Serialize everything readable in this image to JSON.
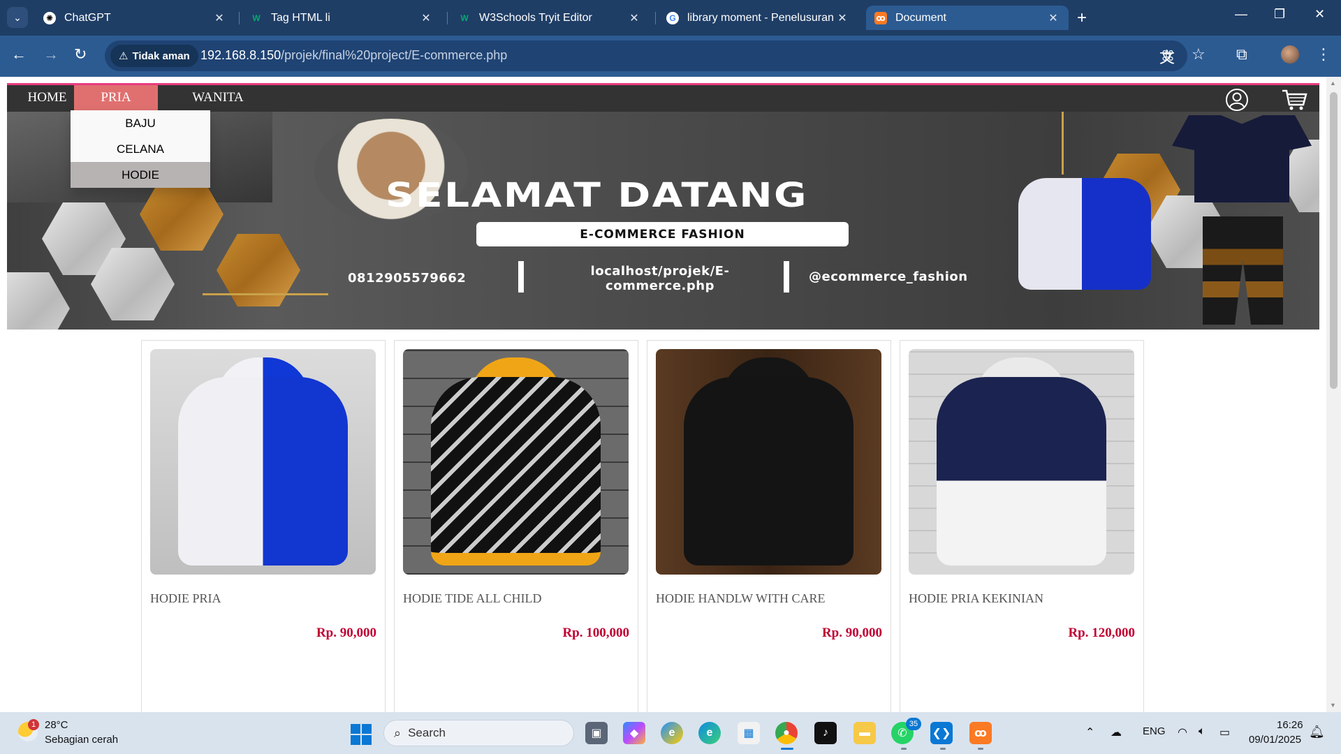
{
  "browser": {
    "tabs": [
      {
        "title": "ChatGPT",
        "icon": "chatgpt-icon"
      },
      {
        "title": "Tag HTML li",
        "icon": "w3-icon"
      },
      {
        "title": "W3Schools Tryit Editor",
        "icon": "w3-icon"
      },
      {
        "title": "library moment - Penelusuran G",
        "icon": "google-icon"
      },
      {
        "title": "Document",
        "icon": "xampp-icon",
        "active": true
      }
    ],
    "security_label": "Tidak aman",
    "url_host": "192.168.8.150",
    "url_path": "/projek/final%20project/E-commerce.php"
  },
  "site": {
    "nav": [
      "HOME",
      "PRIA",
      "WANITA"
    ],
    "active_nav": "PRIA",
    "dropdown": [
      "BAJU",
      "CELANA",
      "HODIE"
    ],
    "dropdown_hover": "HODIE",
    "banner": {
      "title": "SELAMAT DATANG",
      "subtitle": "E-COMMERCE FASHION",
      "phone": "0812905579662",
      "link_line1": "localhost/projek/E-",
      "link_line2": "commerce.php",
      "instagram": "@ecommerce_fashion"
    },
    "products": [
      {
        "name": "HODIE PRIA",
        "price": "Rp. 90,000"
      },
      {
        "name": "HODIE TIDE ALL CHILD",
        "price": "Rp. 100,000"
      },
      {
        "name": "HODIE HANDLW WITH CARE",
        "price": "Rp. 90,000"
      },
      {
        "name": "HODIE PRIA KEKINIAN",
        "price": "Rp. 120,000"
      }
    ],
    "accent_color": "#e73c7e",
    "price_color": "#c00033"
  },
  "taskbar": {
    "weather_temp": "28°C",
    "weather_desc": "Sebagian cerah",
    "weather_badge": "1",
    "search_placeholder": "Search",
    "whatsapp_badge": "35",
    "language": "ENG",
    "time": "16:26",
    "date": "09/01/2025"
  }
}
